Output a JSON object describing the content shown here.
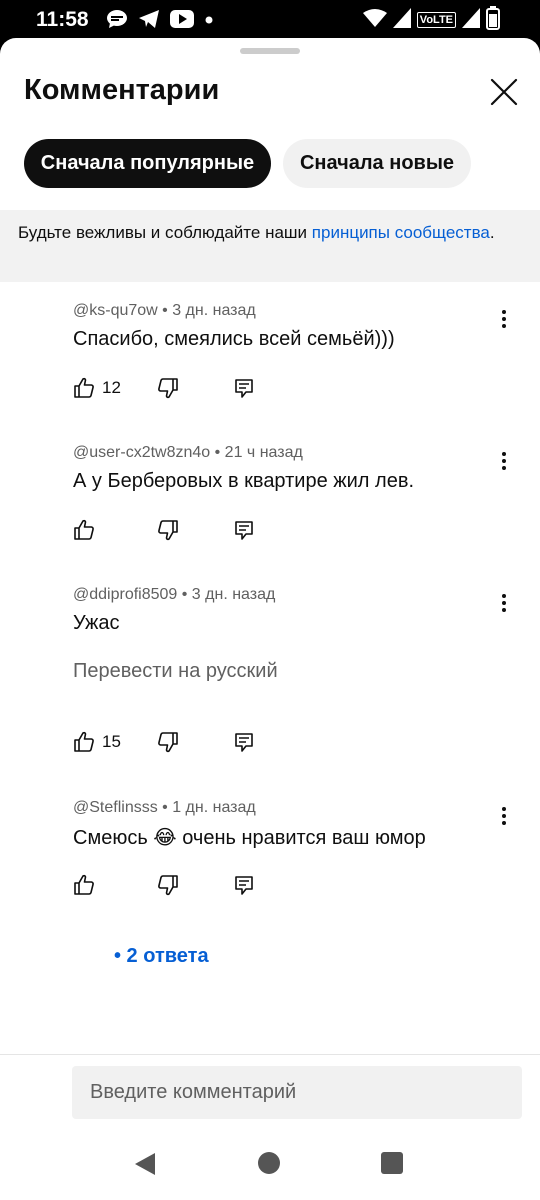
{
  "status_bar": {
    "time": "11:58",
    "notification_icons": [
      "chat-bubble-icon",
      "telegram-icon",
      "youtube-icon",
      "dot-icon"
    ],
    "system_icons": [
      "wifi-icon",
      "signal-icon",
      "volte-icon",
      "signal-icon",
      "battery-icon"
    ],
    "volte_label": "VoLTE"
  },
  "sheet": {
    "title": "Комментарии"
  },
  "filters": {
    "popular_label": "Сначала популярные",
    "new_label": "Сначала новые",
    "selected": "popular"
  },
  "notice": {
    "text": "Будьте вежливы и соблюдайте наши ",
    "link": "принципы сообщества",
    "suffix": "."
  },
  "comments": [
    {
      "meta": "@ks-qu7ow • 3 дн. назад",
      "text": "Спасибо, смеялись всей семьёй)))",
      "likes": "12"
    },
    {
      "meta": "@user-cx2tw8zn4o • 21 ч назад",
      "text": "А у Берберовых в квартире жил лев.",
      "likes": ""
    },
    {
      "meta": "@ddiprofi8509 • 3 дн. назад",
      "text": "Ужас",
      "translate": "Перевести на русский",
      "likes": "15"
    },
    {
      "meta": "@Steflinsss • 1 дн. назад",
      "text": "Смеюсь 😂 очень нравится ваш юмор",
      "likes": ""
    }
  ],
  "replies": {
    "label": "• 2 ответа"
  },
  "composer": {
    "placeholder": "Введите комментарий"
  },
  "colors": {
    "accent_link": "#065fd4",
    "chip_selected_bg": "#0f0f0f",
    "chip_bg": "#f1f1f1",
    "notice_bg": "#f2f2f2",
    "secondary_text": "#606060"
  }
}
